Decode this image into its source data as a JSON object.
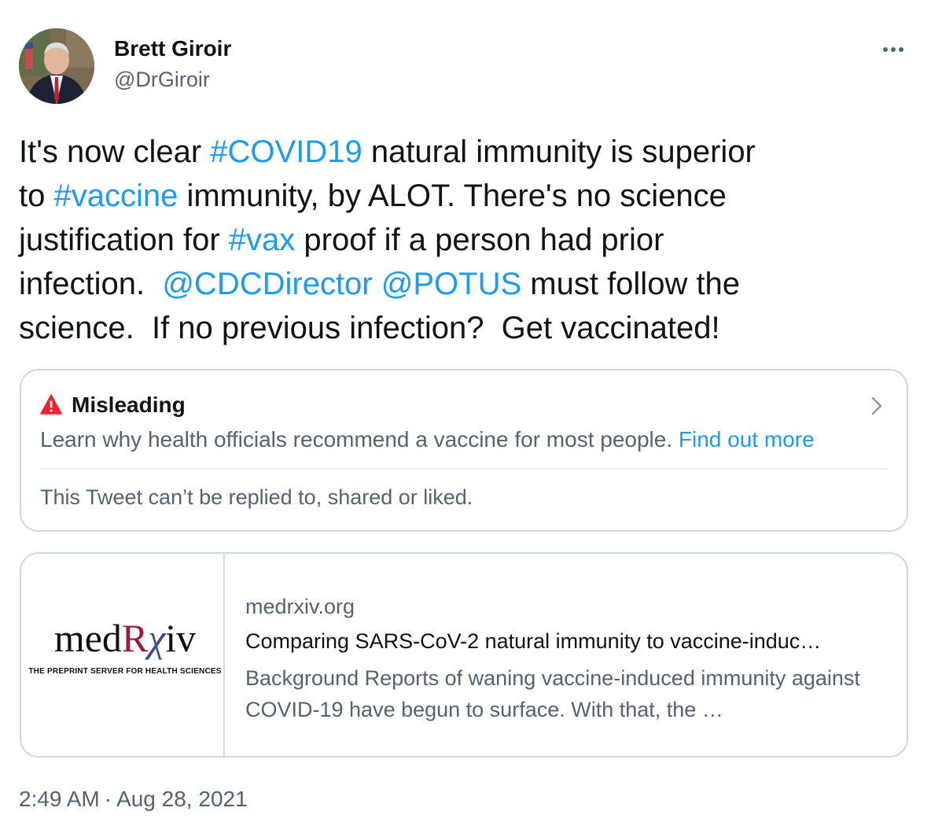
{
  "author": {
    "display_name": "Brett Giroir",
    "handle": "@DrGiroir"
  },
  "tweet": {
    "lines": [
      [
        {
          "text": "It's now clear ",
          "link": false
        },
        {
          "text": "#COVID19",
          "link": true
        },
        {
          "text": " natural immunity is superior",
          "link": false
        }
      ],
      [
        {
          "text": "to ",
          "link": false
        },
        {
          "text": "#vaccine",
          "link": true
        },
        {
          "text": " immunity, by ALOT. There's no science",
          "link": false
        }
      ],
      [
        {
          "text": "justification for ",
          "link": false
        },
        {
          "text": "#vax",
          "link": true
        },
        {
          "text": " proof if a person had prior",
          "link": false
        }
      ],
      [
        {
          "text": "infection.  ",
          "link": false
        },
        {
          "text": "@CDCDirector",
          "link": true
        },
        {
          "text": " ",
          "link": false
        },
        {
          "text": "@POTUS",
          "link": true
        },
        {
          "text": " must follow the",
          "link": false
        }
      ],
      [
        {
          "text": "science.  If no previous infection?  Get vaccinated!",
          "link": false
        }
      ]
    ]
  },
  "notice": {
    "label": "Misleading",
    "description": "Learn why health officials recommend a vaccine for most people.",
    "link_text": "Find out more",
    "note": "This Tweet can’t be replied to, shared or liked."
  },
  "card": {
    "logo_text": "medRxiv",
    "logo_tagline": "THE PREPRINT SERVER FOR HEALTH SCIENCES",
    "domain": "medrxiv.org",
    "title": "Comparing SARS-CoV-2 natural immunity to vaccine-induc…",
    "description": "Background Reports of waning vaccine-induced immunity against COVID-19 have begun to surface. With that, the …"
  },
  "meta": {
    "time": "2:49 AM",
    "separator": "·",
    "date": "Aug 28, 2021"
  },
  "colors": {
    "link": "#1d9bf0",
    "secondary_text": "#536471",
    "warning": "#f4212e",
    "border": "#cfd9de"
  },
  "icons": {
    "more": "more-horizontal-icon",
    "warning": "warning-triangle-icon",
    "chevron": "chevron-right-icon"
  }
}
